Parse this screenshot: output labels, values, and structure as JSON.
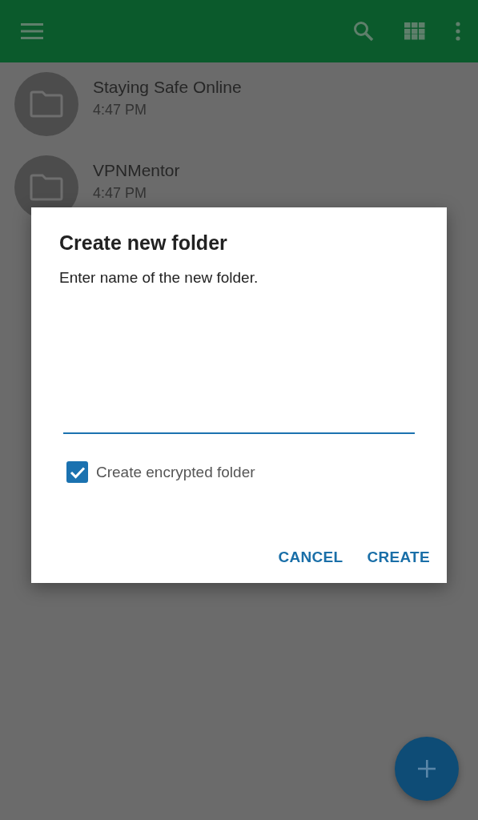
{
  "folders": [
    {
      "name": "Staying Safe Online",
      "time": "4:47 PM"
    },
    {
      "name": "VPNMentor",
      "time": "4:47 PM"
    }
  ],
  "dialog": {
    "title": "Create new folder",
    "message": "Enter name of the new folder.",
    "input": {
      "focused": true
    },
    "checkbox": {
      "label": "Create encrypted folder",
      "checked": true
    },
    "buttons": [
      "CANCEL",
      "CREATE"
    ]
  }
}
